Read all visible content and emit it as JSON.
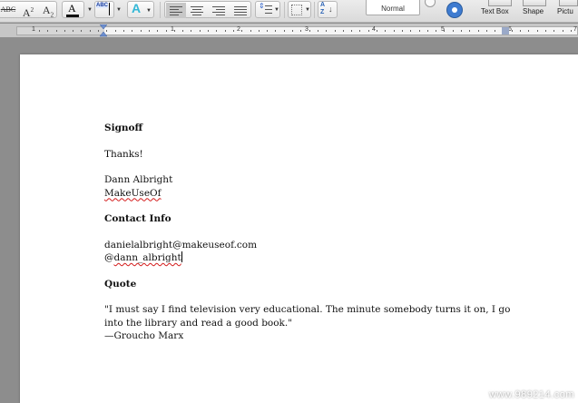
{
  "toolbar": {
    "style_name": "Normal",
    "text_box_label": "Text Box",
    "shape_label": "Shape",
    "picture_label": "Pictu",
    "strikethrough_label": "ABC",
    "superscript_label": "A",
    "subscript_label": "A",
    "font_color_label": "A",
    "highlight_label": "ABC"
  },
  "ruler": {
    "numbers": [
      "1",
      "1",
      "2",
      "3",
      "4",
      "5",
      "6",
      "7"
    ]
  },
  "document": {
    "signoff_heading": "Signoff",
    "thanks": "Thanks!",
    "name": "Dann Albright",
    "company": "MakeUseOf",
    "contact_heading": "Contact Info",
    "email": "danielalbright@makeuseof.com",
    "twitter_at": "@",
    "twitter_handle": "dann_albright",
    "quote_heading": "Quote",
    "quote_line1": "\"I must say I find television very educational. The minute somebody turns it on, I go",
    "quote_line2": "into the library and read a good book.\"",
    "quote_author": "—Groucho Marx"
  },
  "watermark": "www.989214.com",
  "colors": {
    "spell_error": "#d31a1a",
    "page": "#ffffff",
    "background": "#8d8d8d"
  }
}
